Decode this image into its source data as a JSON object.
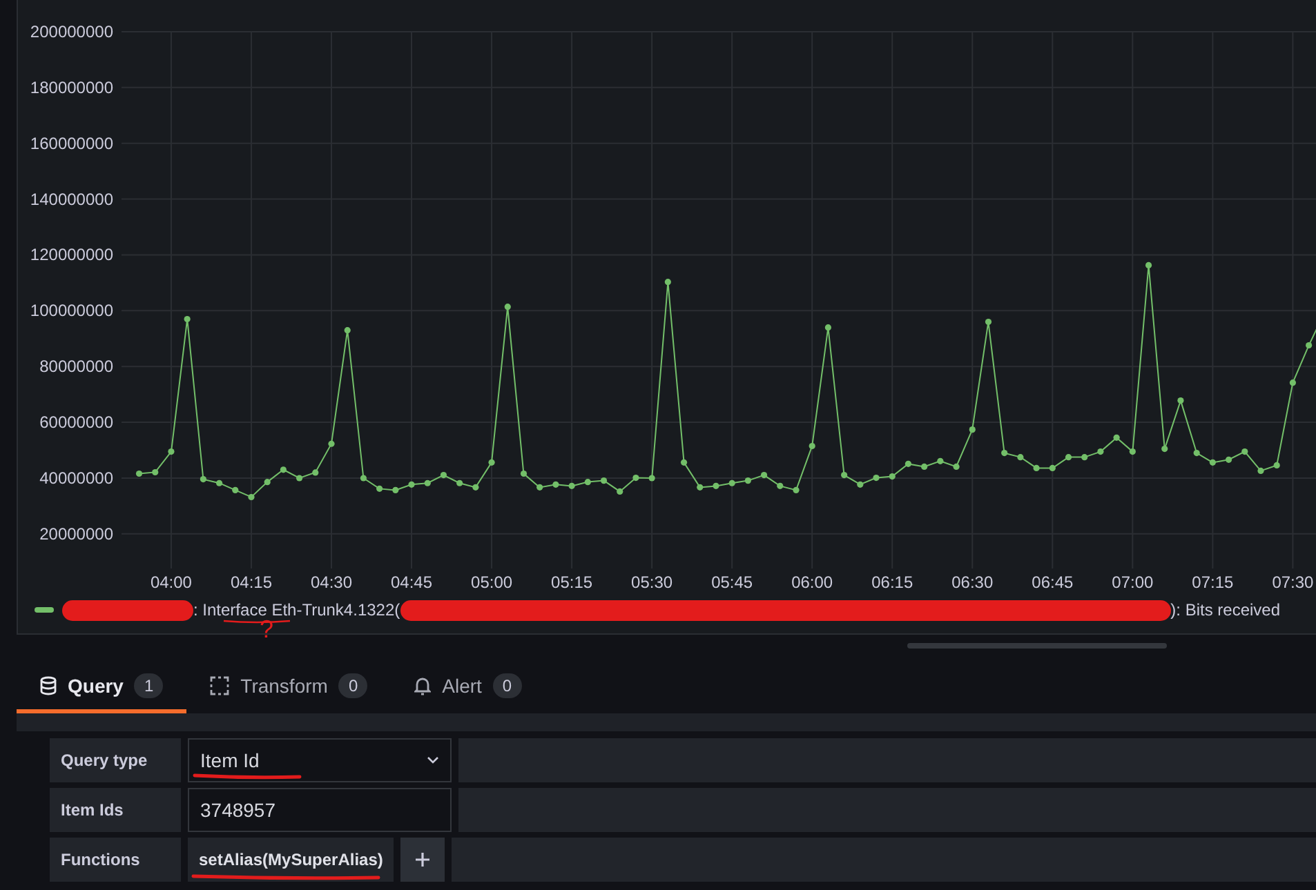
{
  "chart_panel": {
    "chart_data": {
      "type": "line",
      "x": [
        234,
        237,
        240,
        243,
        246,
        249,
        252,
        255,
        258,
        261,
        264,
        267,
        270,
        273,
        276,
        279,
        282,
        285,
        288,
        291,
        294,
        297,
        300,
        303,
        306,
        309,
        312,
        315,
        318,
        321,
        324,
        327,
        330,
        333,
        336,
        339,
        342,
        345,
        348,
        351,
        354,
        357,
        360,
        363,
        366,
        369,
        372,
        375,
        378,
        381,
        384,
        387,
        390,
        393,
        396,
        399,
        402,
        405,
        408,
        411,
        414,
        417,
        420,
        423,
        426,
        429,
        432,
        435,
        438,
        441,
        444,
        447,
        450,
        453,
        454.6
      ],
      "grid": true,
      "series": [
        {
          "name": "Bits received",
          "color": "#73bf69",
          "marker": true,
          "values": [
            41600000,
            42100000,
            49500000,
            97000000,
            39600000,
            38200000,
            35700000,
            33200000,
            38600000,
            43000000,
            40000000,
            42000000,
            52300000,
            93000000,
            40000000,
            36200000,
            35700000,
            37700000,
            38200000,
            41100000,
            38200000,
            36700000,
            45600000,
            101400000,
            41600000,
            36700000,
            37700000,
            37200000,
            38600000,
            39100000,
            35200000,
            40100000,
            40000000,
            110300000,
            45600000,
            36700000,
            37200000,
            38200000,
            39100000,
            41100000,
            37200000,
            35700000,
            51500000,
            94000000,
            41100000,
            37700000,
            40100000,
            40600000,
            45100000,
            44100000,
            46100000,
            44100000,
            57400000,
            96000000,
            49000000,
            47500000,
            43600000,
            43600000,
            47500000,
            47500000,
            49500000,
            54500000,
            49500000,
            116300000,
            50500000,
            67800000,
            49000000,
            45600000,
            46600000,
            49500000,
            42600000,
            44600000,
            74200000,
            87600000,
            94000000
          ]
        }
      ],
      "xlim": [
        230.7,
        454.6
      ],
      "ylim": [
        7600000,
        200000000
      ],
      "xticks": [
        {
          "value": 240,
          "label": "04:00"
        },
        {
          "value": 255,
          "label": "04:15"
        },
        {
          "value": 270,
          "label": "04:30"
        },
        {
          "value": 285,
          "label": "04:45"
        },
        {
          "value": 300,
          "label": "05:00"
        },
        {
          "value": 315,
          "label": "05:15"
        },
        {
          "value": 330,
          "label": "05:30"
        },
        {
          "value": 345,
          "label": "05:45"
        },
        {
          "value": 360,
          "label": "06:00"
        },
        {
          "value": 375,
          "label": "06:15"
        },
        {
          "value": 390,
          "label": "06:30"
        },
        {
          "value": 405,
          "label": "06:45"
        },
        {
          "value": 420,
          "label": "07:00"
        },
        {
          "value": 435,
          "label": "07:15"
        },
        {
          "value": 450,
          "label": "07:30"
        }
      ],
      "yticks": [
        {
          "value": 20000000,
          "label": "20000000"
        },
        {
          "value": 40000000,
          "label": "40000000"
        },
        {
          "value": 60000000,
          "label": "60000000"
        },
        {
          "value": 80000000,
          "label": "80000000"
        },
        {
          "value": 100000000,
          "label": "100000000"
        },
        {
          "value": 120000000,
          "label": "120000000"
        },
        {
          "value": 140000000,
          "label": "140000000"
        },
        {
          "value": 160000000,
          "label": "160000000"
        },
        {
          "value": 180000000,
          "label": "180000000"
        },
        {
          "value": 200000000,
          "label": "200000000"
        }
      ]
    },
    "legend": {
      "color": "#73bf69",
      "parts": [
        {
          "kind": "redacted"
        },
        {
          "kind": "text",
          "text": ": Interface Eth-Trunk4.1322("
        },
        {
          "kind": "redacted"
        },
        {
          "kind": "series_name",
          "text": "): "
        }
      ],
      "note": "?"
    }
  },
  "tabs": [
    {
      "label": "Query",
      "count": "1",
      "selected": true
    },
    {
      "label": "Transform",
      "count": "0",
      "selected": false
    },
    {
      "label": "Alert",
      "count": "0",
      "selected": false
    }
  ],
  "query_rows": [
    {
      "label": "Query type",
      "kind": "select",
      "value": "Item Id",
      "underlined": true
    },
    {
      "label": "Item Ids",
      "kind": "input",
      "value": "3748957",
      "underlined": false
    },
    {
      "label": "Functions",
      "kind": "functions",
      "value": "setAlias(MySuperAlias)",
      "underlined": true
    }
  ]
}
